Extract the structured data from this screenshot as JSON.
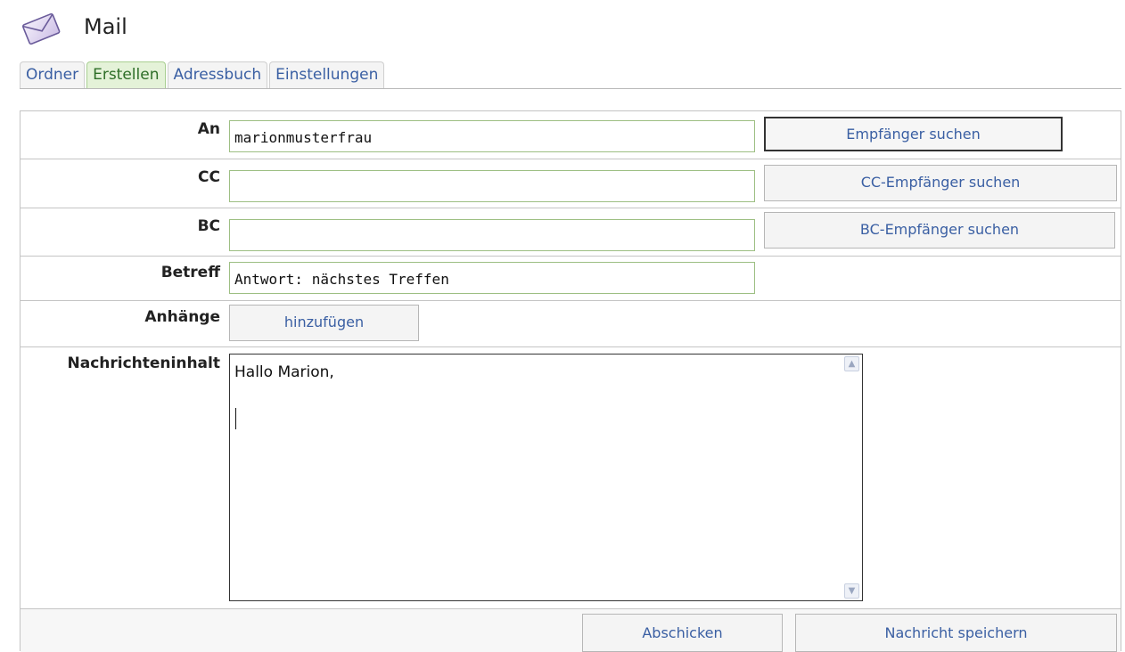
{
  "app": {
    "title": "Mail",
    "icon": "envelope-icon"
  },
  "tabs": [
    {
      "label": "Ordner",
      "active": false
    },
    {
      "label": "Erstellen",
      "active": true
    },
    {
      "label": "Adressbuch",
      "active": false
    },
    {
      "label": "Einstellungen",
      "active": false
    }
  ],
  "form": {
    "to": {
      "label": "An",
      "value": "marionmusterfrau",
      "button": "Empfänger suchen"
    },
    "cc": {
      "label": "CC",
      "value": "",
      "button": "CC-Empfänger suchen"
    },
    "bc": {
      "label": "BC",
      "value": "",
      "button": "BC-Empfänger suchen"
    },
    "subject": {
      "label": "Betreff",
      "value": "Antwort: nächstes Treffen"
    },
    "attachments": {
      "label": "Anhänge",
      "button": "hinzufügen"
    },
    "body": {
      "label": "Nachrichteninhalt",
      "value": "Hallo Marion,"
    }
  },
  "actions": {
    "send": "Abschicken",
    "save": "Nachricht speichern"
  },
  "colors": {
    "link": "#3a5fa3",
    "active_tab_bg": "#e4f2d8",
    "field_border": "#9dbf83"
  }
}
